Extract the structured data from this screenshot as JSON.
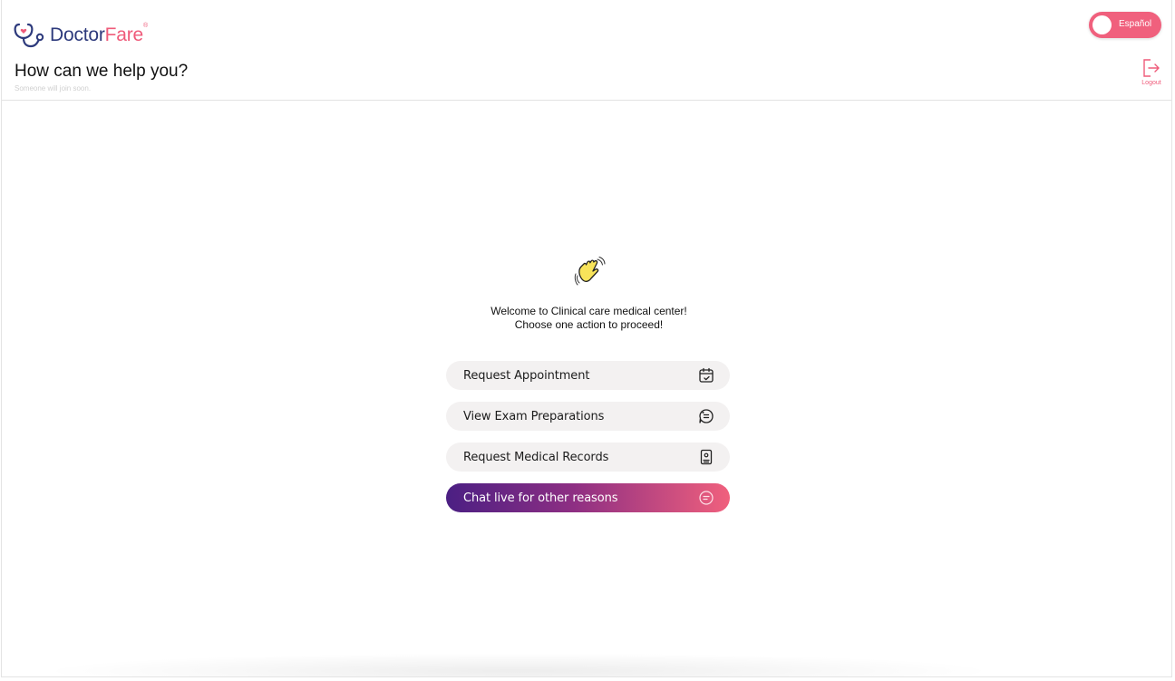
{
  "brand": {
    "name_part1": "Doctor",
    "name_part2": "Fare",
    "mark": "®",
    "icon": "stethoscope-heart-icon",
    "colors": {
      "navy": "#2d3a7c",
      "pink": "#ef5b7a"
    }
  },
  "header": {
    "title": "How can we help you?",
    "subtitle": "Someone will join soon."
  },
  "language_toggle": {
    "label": "Español",
    "color": "#f0607d"
  },
  "logout": {
    "label": "Logout",
    "icon": "logout-icon"
  },
  "welcome": {
    "icon": "waving-hand-icon",
    "line1": "Welcome to Clinical care medical center!",
    "line2": "Choose one action to proceed!"
  },
  "actions": [
    {
      "label": "Request Appointment",
      "icon": "calendar-check-icon"
    },
    {
      "label": "View Exam Preparations",
      "icon": "exam-prep-icon"
    },
    {
      "label": "Request Medical Records",
      "icon": "medical-record-icon"
    },
    {
      "label": "Chat live for other reasons",
      "icon": "chat-bubble-icon",
      "primary": true,
      "gradient": [
        "#4b1f83",
        "#f0607d"
      ]
    }
  ]
}
